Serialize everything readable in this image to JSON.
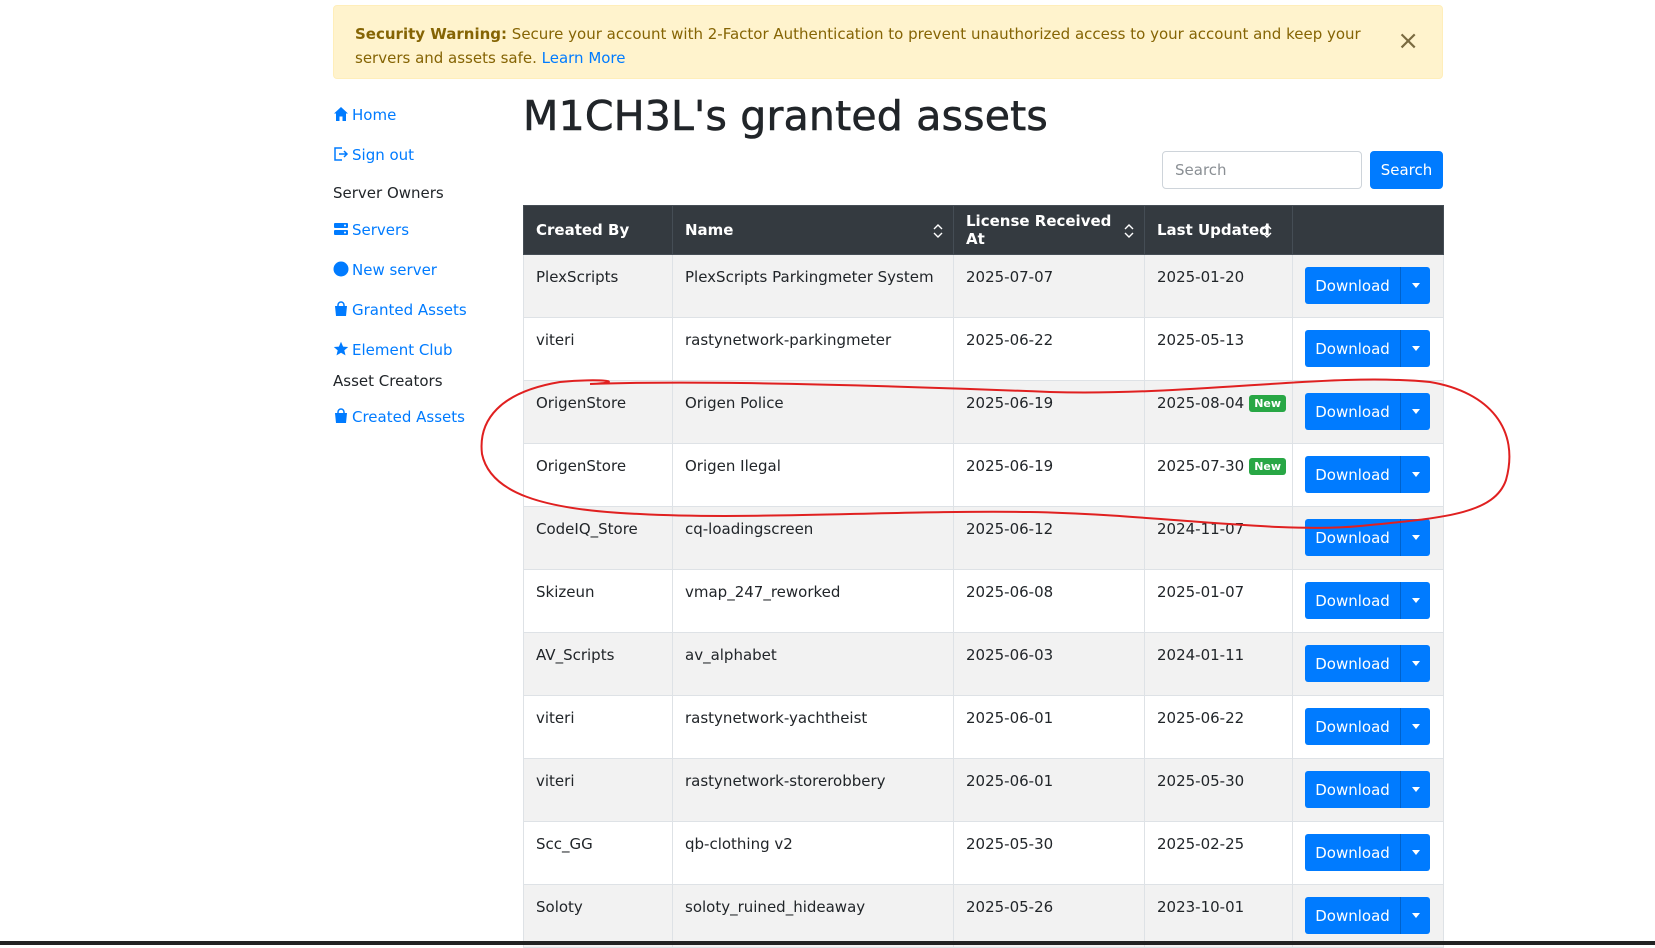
{
  "alert": {
    "title": "Security Warning:",
    "message": " Secure your account with 2-Factor Authentication to prevent unauthorized access to your account and keep your servers and assets safe. ",
    "link": "Learn More",
    "close": "×"
  },
  "sidebar": {
    "home": "Home",
    "sign_out": "Sign out",
    "server_owners": "Server Owners",
    "servers": "Servers",
    "new_server": "New server",
    "granted_assets": "Granted Assets",
    "element_club": "Element Club",
    "asset_creators": "Asset Creators",
    "created_assets": "Created Assets"
  },
  "page": {
    "title": "M1CH3L's granted assets"
  },
  "search": {
    "placeholder": "Search",
    "button": "Search"
  },
  "table": {
    "headers": [
      "Created By",
      "Name",
      "License Received At",
      "Last Updated",
      ""
    ],
    "download_label": "Download",
    "badge_label": "New",
    "rows": [
      {
        "created_by": "PlexScripts",
        "name": "PlexScripts Parkingmeter System",
        "received": "2025-07-07",
        "updated": "2025-01-20",
        "new": false
      },
      {
        "created_by": "viteri",
        "name": "rastynetwork-parkingmeter",
        "received": "2025-06-22",
        "updated": "2025-05-13",
        "new": false
      },
      {
        "created_by": "OrigenStore",
        "name": "Origen Police",
        "received": "2025-06-19",
        "updated": "2025-08-04",
        "new": true
      },
      {
        "created_by": "OrigenStore",
        "name": "Origen Ilegal",
        "received": "2025-06-19",
        "updated": "2025-07-30",
        "new": true
      },
      {
        "created_by": "CodeIQ_Store",
        "name": "cq-loadingscreen",
        "received": "2025-06-12",
        "updated": "2024-11-07",
        "new": false
      },
      {
        "created_by": "Skizeun",
        "name": "vmap_247_reworked",
        "received": "2025-06-08",
        "updated": "2025-01-07",
        "new": false
      },
      {
        "created_by": "AV_Scripts",
        "name": "av_alphabet",
        "received": "2025-06-03",
        "updated": "2024-01-11",
        "new": false
      },
      {
        "created_by": "viteri",
        "name": "rastynetwork-yachtheist",
        "received": "2025-06-01",
        "updated": "2025-06-22",
        "new": false
      },
      {
        "created_by": "viteri",
        "name": "rastynetwork-storerobbery",
        "received": "2025-06-01",
        "updated": "2025-05-30",
        "new": false
      },
      {
        "created_by": "Scc_GG",
        "name": "qb-clothing v2",
        "received": "2025-05-30",
        "updated": "2025-02-25",
        "new": false
      },
      {
        "created_by": "Soloty",
        "name": "soloty_ruined_hideaway",
        "received": "2025-05-26",
        "updated": "2023-10-01",
        "new": false
      }
    ]
  },
  "colors": {
    "primary": "#007bff",
    "header_bg": "#343a40",
    "badge": "#28a745",
    "alert_bg": "#fff3cd",
    "annotation": "#e02020"
  }
}
